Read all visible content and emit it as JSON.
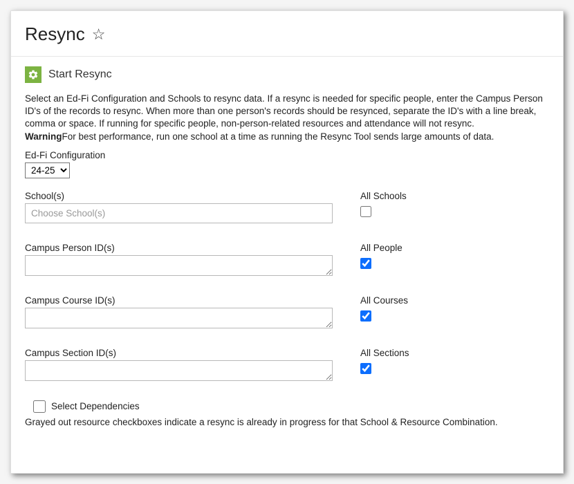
{
  "header": {
    "title": "Resync"
  },
  "section": {
    "title": "Start Resync",
    "description_plain": "Select an Ed-Fi Configuration and Schools to resync data. If a resync is needed for specific people, enter the Campus Person ID's of the records to resync. When more than one person's records should be resynced, separate the ID's with a line break, comma or space. If running for specific people, non-person-related resources and attendance will not resync.",
    "warning_label": "Warning",
    "warning_text": "For best performance, run one school at a time as running the Resync Tool sends large amounts of data."
  },
  "config": {
    "label": "Ed-Fi Configuration",
    "selected": "24-25"
  },
  "fields": {
    "schools": {
      "label": "School(s)",
      "placeholder": "Choose School(s)",
      "all_label": "All Schools",
      "all_checked": false
    },
    "person": {
      "label": "Campus Person ID(s)",
      "value": "",
      "all_label": "All People",
      "all_checked": true
    },
    "course": {
      "label": "Campus Course ID(s)",
      "value": "",
      "all_label": "All Courses",
      "all_checked": true
    },
    "section": {
      "label": "Campus Section ID(s)",
      "value": "",
      "all_label": "All Sections",
      "all_checked": true
    }
  },
  "deps": {
    "label": "Select Dependencies",
    "checked": false
  },
  "footer_note": "Grayed out resource checkboxes indicate a resync is already in progress for that School & Resource Combination."
}
